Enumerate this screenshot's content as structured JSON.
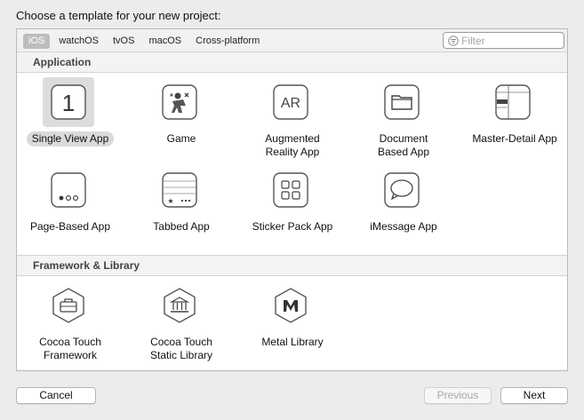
{
  "dialog": {
    "title": "Choose a template for your new project:"
  },
  "platform_tabs": [
    {
      "label": "iOS",
      "selected": true
    },
    {
      "label": "watchOS",
      "selected": false
    },
    {
      "label": "tvOS",
      "selected": false
    },
    {
      "label": "macOS",
      "selected": false
    },
    {
      "label": "Cross-platform",
      "selected": false
    }
  ],
  "filter": {
    "placeholder": "Filter",
    "value": ""
  },
  "sections": {
    "application": {
      "header": "Application",
      "templates": [
        {
          "label": "Single View App",
          "icon": "single-view-icon",
          "selected": true
        },
        {
          "label": "Game",
          "icon": "game-icon"
        },
        {
          "label": "Augmented\nReality App",
          "icon": "ar-icon"
        },
        {
          "label": "Document\nBased App",
          "icon": "document-folder-icon"
        },
        {
          "label": "Master-Detail App",
          "icon": "master-detail-icon"
        },
        {
          "label": "Page-Based App",
          "icon": "page-dots-icon"
        },
        {
          "label": "Tabbed App",
          "icon": "tab-bar-icon"
        },
        {
          "label": "Sticker Pack App",
          "icon": "sticker-grid-icon"
        },
        {
          "label": "iMessage App",
          "icon": "message-bubble-icon"
        }
      ]
    },
    "framework": {
      "header": "Framework & Library",
      "templates": [
        {
          "label": "Cocoa Touch\nFramework",
          "icon": "toolbox-hexagon-icon"
        },
        {
          "label": "Cocoa Touch\nStatic Library",
          "icon": "library-hexagon-icon"
        },
        {
          "label": "Metal Library",
          "icon": "metal-hexagon-icon"
        }
      ]
    }
  },
  "buttons": {
    "cancel": "Cancel",
    "previous": "Previous",
    "next": "Next"
  }
}
